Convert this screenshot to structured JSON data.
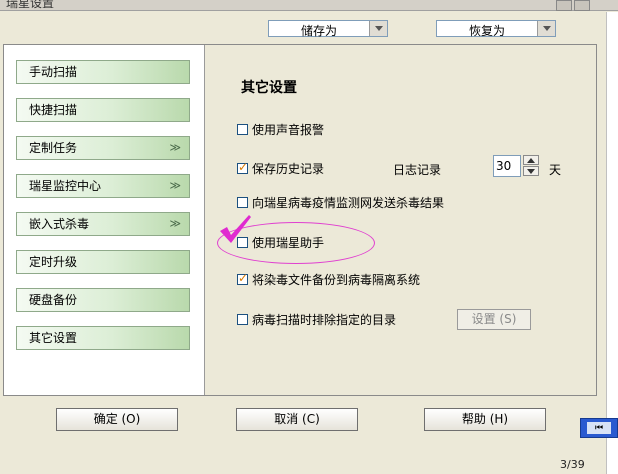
{
  "window": {
    "title": "瑞星设置"
  },
  "toolbar": {
    "save_as": "储存为",
    "restore_to": "恢复为"
  },
  "sidebar": {
    "items": [
      {
        "label": "手动扫描",
        "expandable": false
      },
      {
        "label": "快捷扫描",
        "expandable": false
      },
      {
        "label": "定制任务",
        "expandable": true,
        "icon": "chevron-double-down"
      },
      {
        "label": "瑞星监控中心",
        "expandable": true,
        "icon": "chevron-double-down"
      },
      {
        "label": "嵌入式杀毒",
        "expandable": true,
        "icon": "chevron-double-down"
      },
      {
        "label": "定时升级",
        "expandable": false
      },
      {
        "label": "硬盘备份",
        "expandable": false
      },
      {
        "label": "其它设置",
        "expandable": false
      }
    ]
  },
  "content": {
    "heading": "其它设置",
    "options": {
      "sound_alert": {
        "label": "使用声音报警",
        "checked": false
      },
      "save_history": {
        "label": "保存历史记录",
        "checked": true
      },
      "log_label": "日志记录",
      "log_days": "30",
      "log_unit": "天",
      "send_results": {
        "label": "向瑞星病毒疫情监测网发送杀毒结果",
        "checked": false
      },
      "use_assistant": {
        "label": "使用瑞星助手",
        "checked": false
      },
      "backup_infected": {
        "label": "将染毒文件备份到病毒隔离系统",
        "checked": true
      },
      "exclude_dirs": {
        "label": "病毒扫描时排除指定的目录",
        "checked": false
      }
    },
    "settings_button": "设置 (S)"
  },
  "footer": {
    "ok": "确定 (O)",
    "cancel": "取消 (C)",
    "help": "帮助 (H)"
  },
  "page_indicator": "3/39",
  "colors": {
    "window_bg": "#ece9d8",
    "nav_gradient_end": "#b9d9ac",
    "annotation": "#e040d0",
    "check_accent": "#d97a00"
  }
}
